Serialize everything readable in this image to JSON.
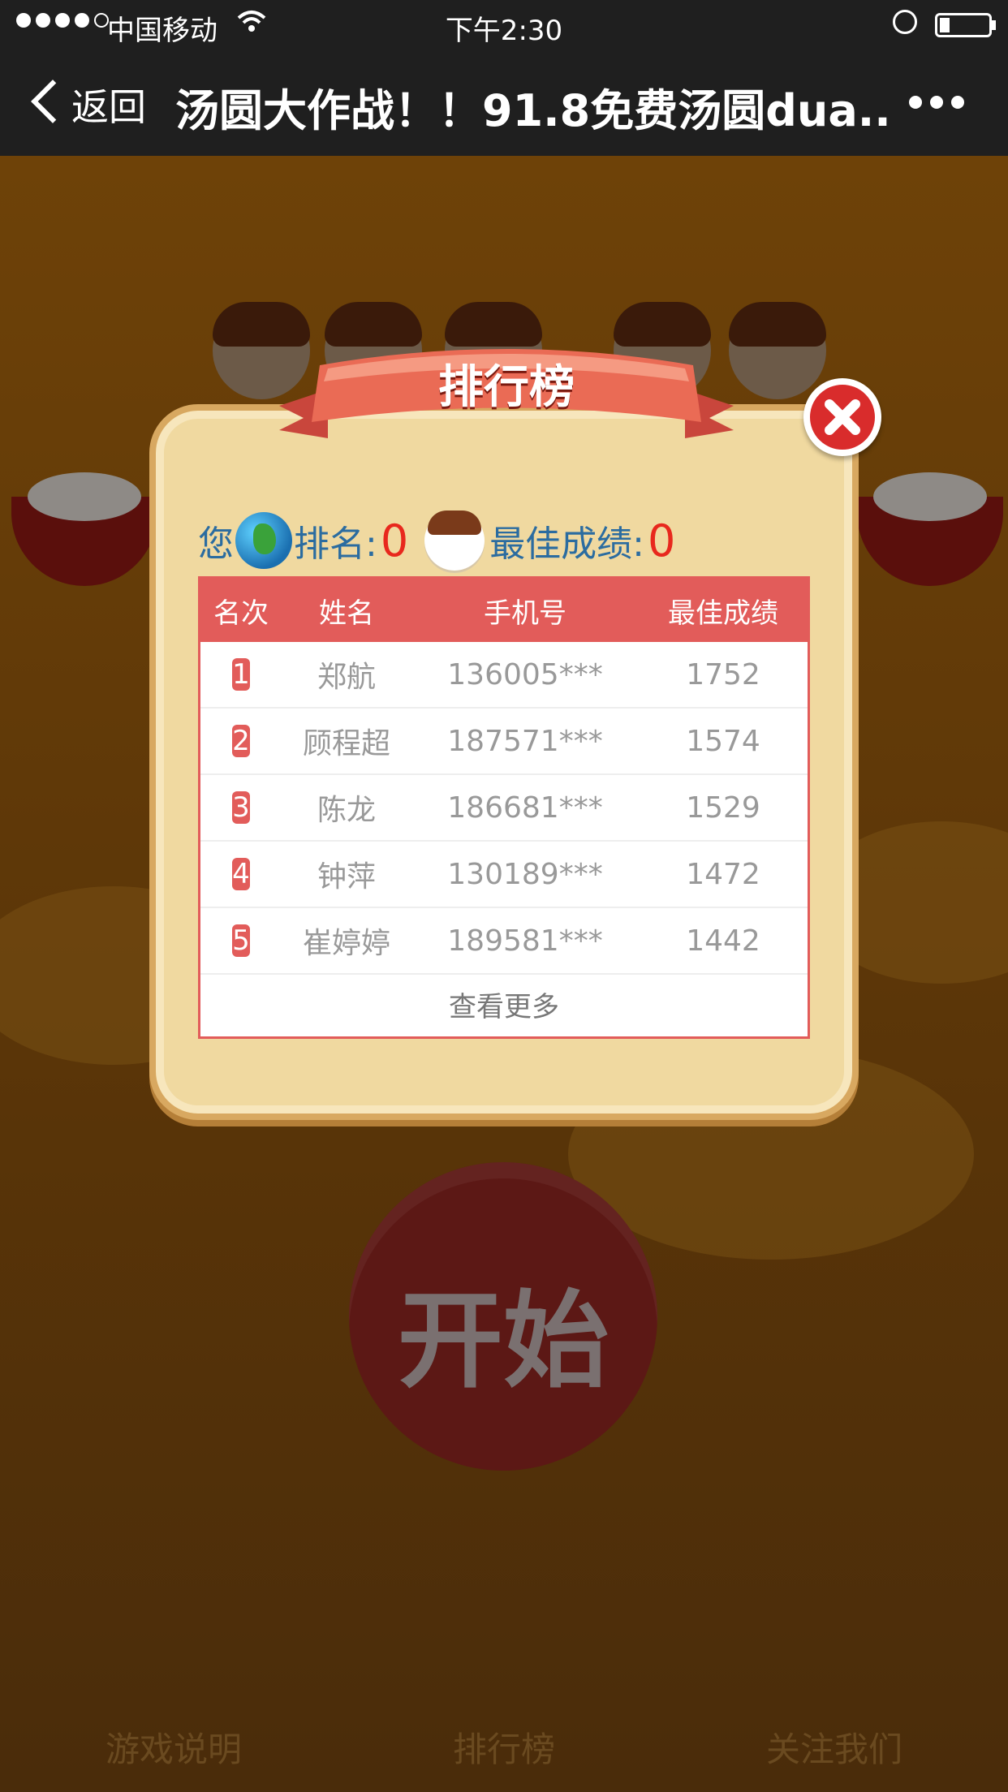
{
  "status_bar": {
    "carrier": "中国移动",
    "time": "下午2:30"
  },
  "nav": {
    "back_label": "返回",
    "title": "汤圆大作战！！91.8免费汤圆dua..."
  },
  "modal": {
    "title": "排行榜",
    "user_prefix": "您",
    "rank_label": "排名:",
    "rank_value": "0",
    "best_label": "最佳成绩:",
    "best_value": "0",
    "headers": [
      "名次",
      "姓名",
      "手机号",
      "最佳成绩"
    ],
    "rows": [
      {
        "rank": "1",
        "name": "郑航",
        "phone": "136005***",
        "score": "1752"
      },
      {
        "rank": "2",
        "name": "顾程超",
        "phone": "187571***",
        "score": "1574"
      },
      {
        "rank": "3",
        "name": "陈龙",
        "phone": "186681***",
        "score": "1529"
      },
      {
        "rank": "4",
        "name": "钟萍",
        "phone": "130189***",
        "score": "1472"
      },
      {
        "rank": "5",
        "name": "崔婷婷",
        "phone": "189581***",
        "score": "1442"
      }
    ],
    "more_label": "查看更多"
  },
  "game": {
    "start_label": "开始",
    "menu": [
      "游戏说明",
      "排行榜",
      "关注我们"
    ]
  },
  "colors": {
    "accent_red": "#e25c5a",
    "score_red": "#e8281d",
    "label_blue": "#2b6ca0"
  }
}
